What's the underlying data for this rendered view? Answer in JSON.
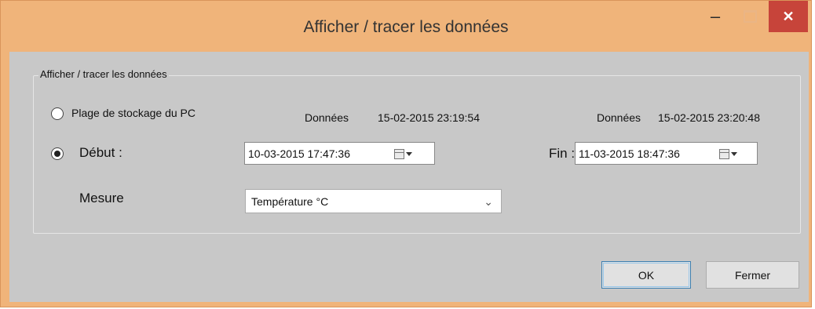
{
  "window": {
    "title": "Afficher / tracer les données",
    "minimize_glyph": "–",
    "close_glyph": "✕"
  },
  "group": {
    "legend": "Afficher / tracer les données"
  },
  "range_option": {
    "label": "Plage de stockage du PC",
    "selected": false,
    "start_label": "Données",
    "start_value": "15-02-2015 23:19:54",
    "end_label": "Données",
    "end_value": "15-02-2015 23:20:48"
  },
  "custom_option": {
    "label": "Début :",
    "selected": true,
    "start_value": "10-03-2015 17:47:36",
    "end_label": "Fin :",
    "end_value": "11-03-2015 18:47:36"
  },
  "measure": {
    "label": "Mesure",
    "selected": "Température °C",
    "chevron": "⌄"
  },
  "buttons": {
    "ok": "OK",
    "close": "Fermer"
  },
  "colors": {
    "titlebar": "#f0b47a",
    "close_button": "#c7443a",
    "client_background": "#c8c8c8"
  }
}
